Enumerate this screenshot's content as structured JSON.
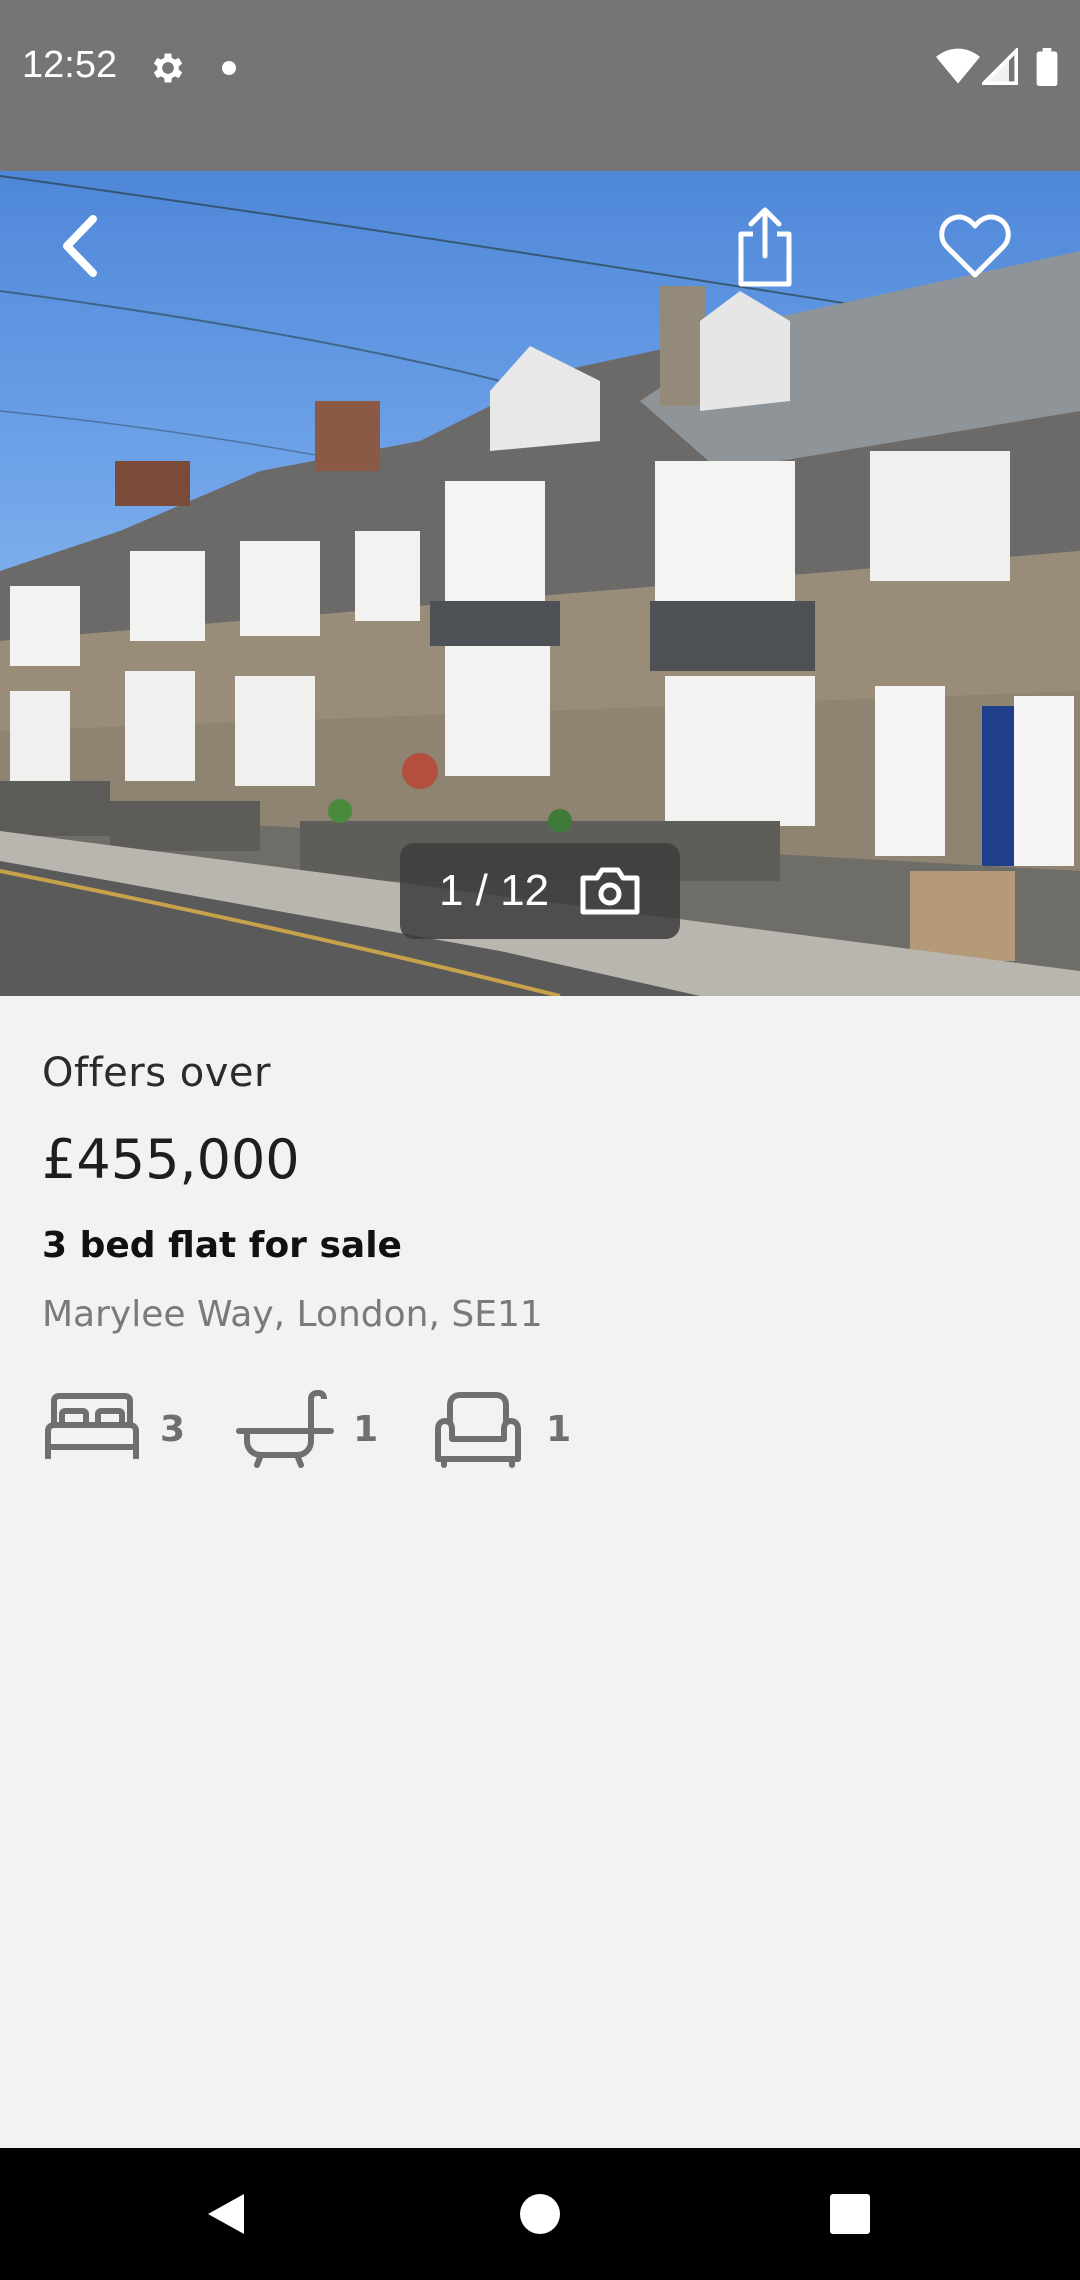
{
  "status_bar": {
    "time": "12:52",
    "icons": [
      "gear-icon",
      "dot-icon",
      "wifi-icon",
      "signal-icon",
      "battery-icon"
    ]
  },
  "gallery": {
    "photo_counter": "1 / 12",
    "icons": [
      "back-arrow-icon",
      "share-icon",
      "heart-icon",
      "camera-icon"
    ]
  },
  "listing": {
    "price_qualifier": "Offers over",
    "price": "£455,000",
    "title": "3 bed flat for sale",
    "address": "Marylee Way, London, SE11",
    "features": {
      "bedrooms": "3",
      "bathrooms": "1",
      "reception_rooms": "1"
    }
  },
  "nav_bar": {
    "icons": [
      "nav-back-icon",
      "nav-home-icon",
      "nav-recents-icon"
    ]
  },
  "colors": {
    "status_bar": "#757575",
    "background": "#f2f2f2",
    "icon_grey": "#6f6f6f",
    "sky": "#6da2e8"
  }
}
